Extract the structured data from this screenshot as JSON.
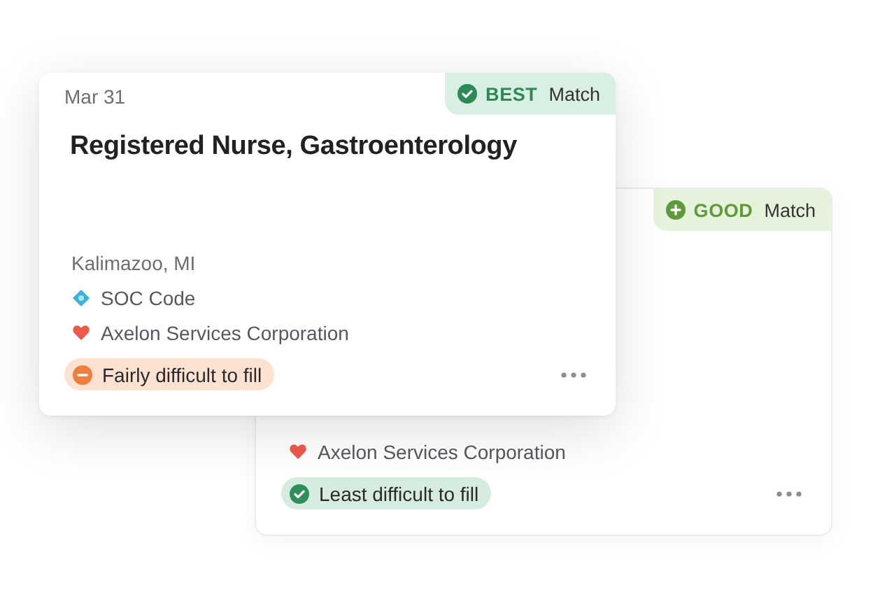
{
  "cards": [
    {
      "date": "Mar 31",
      "match": {
        "kind": "best",
        "grade": "BEST",
        "label": "Match"
      },
      "title": "Registered Nurse, Gastroenterology",
      "location": "Kalimazoo, MI",
      "soc_code": "SOC Code",
      "company": "Axelon Services Corporation",
      "difficulty": {
        "kind": "fairly",
        "label": "Fairly difficult to fill"
      }
    },
    {
      "match": {
        "kind": "good",
        "grade": "GOOD",
        "label": "Match"
      },
      "company": "Axelon Services Corporation",
      "difficulty": {
        "kind": "least",
        "label": "Least difficult to fill"
      }
    }
  ]
}
